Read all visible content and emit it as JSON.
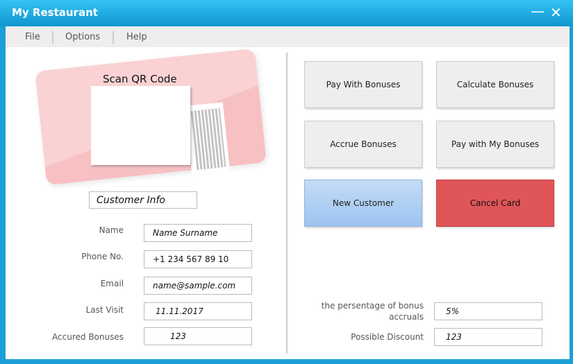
{
  "window": {
    "title": "My Restaurant",
    "minimize": "—",
    "close": "✕"
  },
  "menu": [
    "File",
    "Options",
    "Help"
  ],
  "card": {
    "title": "Scan QR Code"
  },
  "customer_info": {
    "heading": "Customer Info",
    "fields": [
      {
        "label": "Name",
        "value": "Name Surname"
      },
      {
        "label": "Phone No.",
        "value": "+1 234 567 89 10"
      },
      {
        "label": "Email",
        "value": "name@sample.com"
      },
      {
        "label": "Last Visit",
        "value": "11.11.2017"
      },
      {
        "label": "Accured Bonuses",
        "value": "123"
      }
    ]
  },
  "buttons": {
    "pay_with_bonuses": "Pay With Bonuses",
    "calculate_bonuses": "Calculate Bonuses",
    "accrue_bonuses": "Accrue Bonuses",
    "pay_with_my_bonuses": "Pay with My Bonuses",
    "new_customer": "New Customer",
    "cancel_card": "Cancel Card"
  },
  "bonus": {
    "percentage_label": "the persentage of bonus accruals",
    "percentage_value": "5%",
    "discount_label": "Possible Discount",
    "discount_value": "123"
  }
}
